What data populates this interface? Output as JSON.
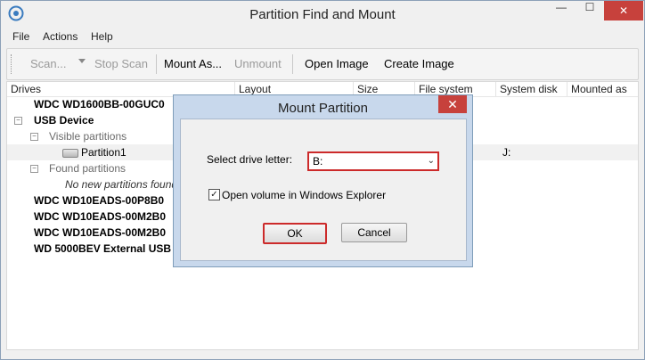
{
  "window": {
    "title": "Partition Find and Mount",
    "min_glyph": "—",
    "max_glyph": "☐",
    "close_glyph": "✕"
  },
  "menu": [
    "File",
    "Actions",
    "Help"
  ],
  "toolbar": {
    "scan": "Scan...",
    "stop_scan": "Stop Scan",
    "mount_as": "Mount As...",
    "unmount": "Unmount",
    "open_image": "Open Image",
    "create_image": "Create Image"
  },
  "columns": [
    "Drives",
    "Layout",
    "Size",
    "File system",
    "System disk",
    "Mounted as"
  ],
  "tree": {
    "drive1": "WDC WD1600BB-00GUC0",
    "usb": "USB Device",
    "visible": "Visible partitions",
    "partition": "Partition1",
    "partition_mount": "J:",
    "found": "Found partitions",
    "none_found": "No new partitions found",
    "drive2": "WDC WD10EADS-00P8B0",
    "drive3": "WDC WD10EADS-00M2B0",
    "drive4": "WDC WD10EADS-00M2B0",
    "drive5": "WD 5000BEV External USB De",
    "minus": "−"
  },
  "dialog": {
    "title": "Mount Partition",
    "close_glyph": "✕",
    "drive_label": "Select drive letter:",
    "drive_value": "B:",
    "arrow": "⌄",
    "check_mark": "✓",
    "check_label": "Open volume in Windows Explorer",
    "ok": "OK",
    "cancel": "Cancel"
  },
  "colors": {
    "accent_red": "#cc2a2a",
    "close_red": "#c7413c",
    "dialog_frame": "#c8d8ec"
  }
}
